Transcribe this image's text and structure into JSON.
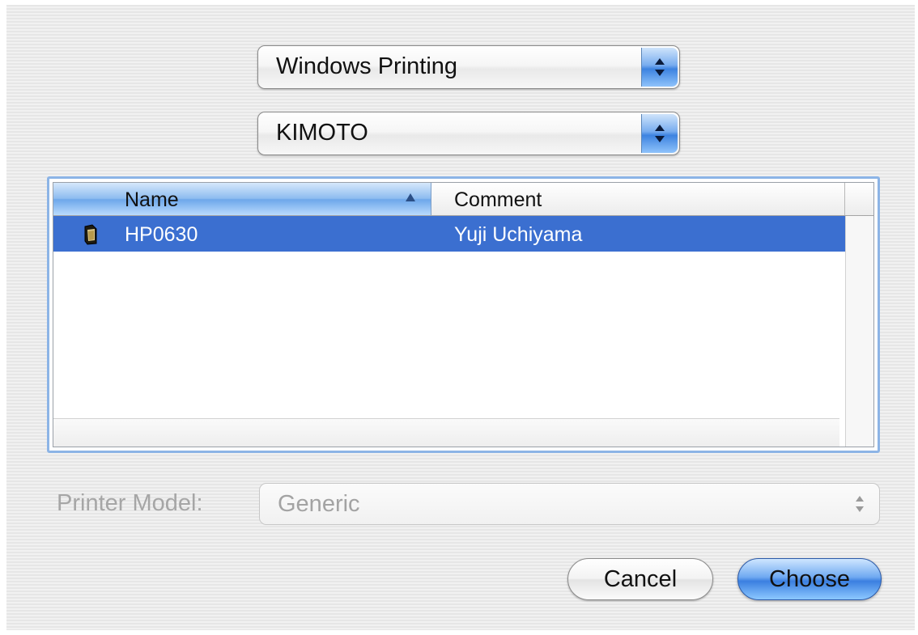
{
  "dialog": {
    "service_popup": {
      "value": "Windows Printing"
    },
    "workgroup_popup": {
      "value": "KIMOTO"
    },
    "printer_table": {
      "columns": {
        "name": "Name",
        "comment": "Comment"
      },
      "sort_column": "Name",
      "sort_direction": "ascending",
      "rows": [
        {
          "name": "HP0630",
          "comment": "Yuji Uchiyama",
          "selected": true,
          "icon": "printer-icon"
        }
      ]
    },
    "printer_model": {
      "label": "Printer Model:",
      "value": "Generic",
      "enabled": false
    },
    "buttons": {
      "cancel": "Cancel",
      "choose": "Choose"
    }
  },
  "colors": {
    "selection": "#3b6fd0",
    "accent": "#3d83e0",
    "disabled_text": "#a6a6a6"
  }
}
